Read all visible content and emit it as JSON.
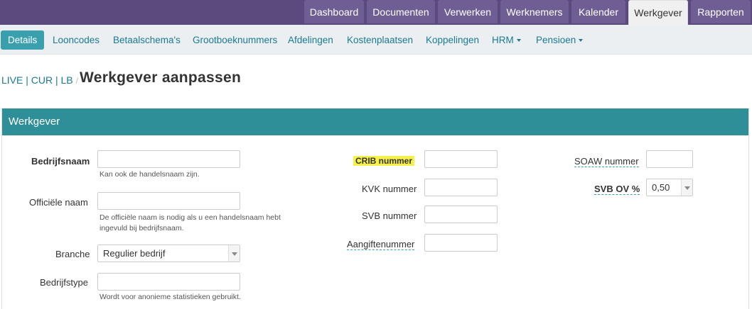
{
  "topnav": {
    "tabs": [
      {
        "label": "Dashboard",
        "active": false
      },
      {
        "label": "Documenten",
        "active": false
      },
      {
        "label": "Verwerken",
        "active": false
      },
      {
        "label": "Werknemers",
        "active": false
      },
      {
        "label": "Kalender",
        "active": false
      },
      {
        "label": "Werkgever",
        "active": true
      },
      {
        "label": "Rapporten",
        "active": false
      }
    ]
  },
  "subnav": {
    "items": [
      {
        "label": "Details",
        "active": true
      },
      {
        "label": "Looncodes"
      },
      {
        "label": "Betaalschema's"
      },
      {
        "label": "Grootboeknummers"
      },
      {
        "label": "Afdelingen"
      },
      {
        "label": "Kostenplaatsen"
      },
      {
        "label": "Koppelingen"
      },
      {
        "label": "HRM",
        "dropdown": true
      },
      {
        "label": "Pensioen",
        "dropdown": true
      }
    ]
  },
  "breadcrumb": "LIVE | CUR | LB",
  "page_title": "Werkgever aanpassen",
  "panel": {
    "title": "Werkgever",
    "col1": {
      "bedrijfsnaam_label": "Bedrijfsnaam",
      "bedrijfsnaam_value": "",
      "bedrijfsnaam_help": "Kan ook de handelsnaam zijn.",
      "officiele_naam_label": "Officiële naam",
      "officiele_naam_value": "",
      "officiele_naam_help_1": "De officiële naam is nodig als u een handelsnaam hebt",
      "officiele_naam_help_2": "ingevuld bij bedrijfsnaam.",
      "branche_label": "Branche",
      "branche_value": "Regulier bedrijf",
      "bedrijfstype_label": "Bedrijfstype",
      "bedrijfstype_value": "",
      "bedrijfstype_help": "Wordt voor anonieme statistieken gebruikt."
    },
    "col2": {
      "crib_label": "CRIB nummer",
      "kvk_label": "KVK nummer",
      "svb_label": "SVB nummer",
      "aangifte_label": "Aangiftenummer"
    },
    "col3": {
      "soaw_label": "SOAW nummer",
      "svb_ov_label": "SVB OV %",
      "svb_ov_value": "0,50"
    }
  },
  "colors": {
    "topbar": "#5b4a7e",
    "tab": "#6f5e94",
    "accent": "#3aa0ae",
    "panel_header": "#2f8f98",
    "link": "#1a7a92",
    "highlight": "#f6f04b"
  }
}
